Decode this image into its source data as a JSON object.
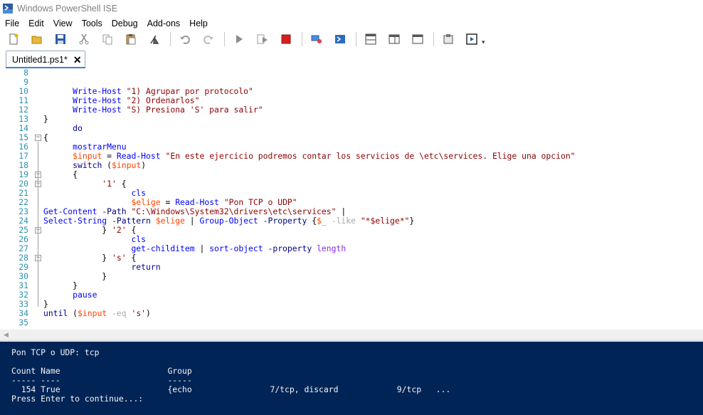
{
  "window": {
    "title": "Windows PowerShell ISE"
  },
  "menu": [
    "File",
    "Edit",
    "View",
    "Tools",
    "Debug",
    "Add-ons",
    "Help"
  ],
  "toolbar": {
    "icons": [
      "new-icon",
      "open-icon",
      "save-icon",
      "cut-icon",
      "copy-icon",
      "paste-icon",
      "clear-icon",
      "undo-icon",
      "redo-icon",
      "run-icon",
      "run-selection-icon",
      "stop-icon",
      "remote-icon",
      "powershell-icon",
      "script-pane-top-icon",
      "script-pane-right-icon",
      "script-pane-max-icon",
      "command-addon-icon",
      "show-script-pane-icon"
    ],
    "colors": {
      "run": "#8c8c8c",
      "stop": "#d42020",
      "accent": "#3c7fd6"
    }
  },
  "tab": {
    "label": "Untitled1.ps1*",
    "close": "✕"
  },
  "editor": {
    "lines": [
      {
        "n": "8",
        "t": ""
      },
      {
        "n": "9",
        "t": ""
      },
      {
        "n": "10",
        "t": "      Write-Host \"1) Agrupar por protocolo\""
      },
      {
        "n": "11",
        "t": "      Write-Host \"2) Ordenarlos\""
      },
      {
        "n": "12",
        "t": "      Write-Host \"S) Presiona 'S' para salir\""
      },
      {
        "n": "13",
        "t": "}"
      },
      {
        "n": "14",
        "t": "      do"
      },
      {
        "n": "15",
        "t": "{"
      },
      {
        "n": "16",
        "t": "      mostrarMenu"
      },
      {
        "n": "17",
        "t": "      $input = Read-Host \"En este ejercicio podremos contar los servicios de \\etc\\services. Elige una opcion\""
      },
      {
        "n": "18",
        "t": "      switch ($input)"
      },
      {
        "n": "19",
        "t": "      {"
      },
      {
        "n": "20",
        "t": "            '1' {"
      },
      {
        "n": "21",
        "t": "                  cls"
      },
      {
        "n": "22",
        "t": "                  $elige = Read-Host \"Pon TCP o UDP\""
      },
      {
        "n": "23",
        "t": "Get-Content -Path \"C:\\Windows\\System32\\drivers\\etc\\services\" |"
      },
      {
        "n": "24",
        "t": "Select-String -Pattern $elige | Group-Object -Property {$_ -like \"*$elige*\"}"
      },
      {
        "n": "25",
        "t": "            } '2' {"
      },
      {
        "n": "26",
        "t": "                  cls"
      },
      {
        "n": "27",
        "t": "                  get-childitem | sort-object -property length"
      },
      {
        "n": "28",
        "t": "            } 's' {"
      },
      {
        "n": "29",
        "t": "                  return"
      },
      {
        "n": "30",
        "t": "            }"
      },
      {
        "n": "31",
        "t": "      }"
      },
      {
        "n": "32",
        "t": "      pause"
      },
      {
        "n": "33",
        "t": "}"
      },
      {
        "n": "34",
        "t": "until ($input -eq 's')"
      },
      {
        "n": "35",
        "t": ""
      }
    ]
  },
  "console": {
    "lines": [
      "Pon TCP o UDP: tcp",
      "",
      "Count Name                      Group",
      "----- ----                      -----",
      "  154 True                      {echo                7/tcp, discard            9/tcp   ...",
      "Press Enter to continue...:"
    ]
  }
}
